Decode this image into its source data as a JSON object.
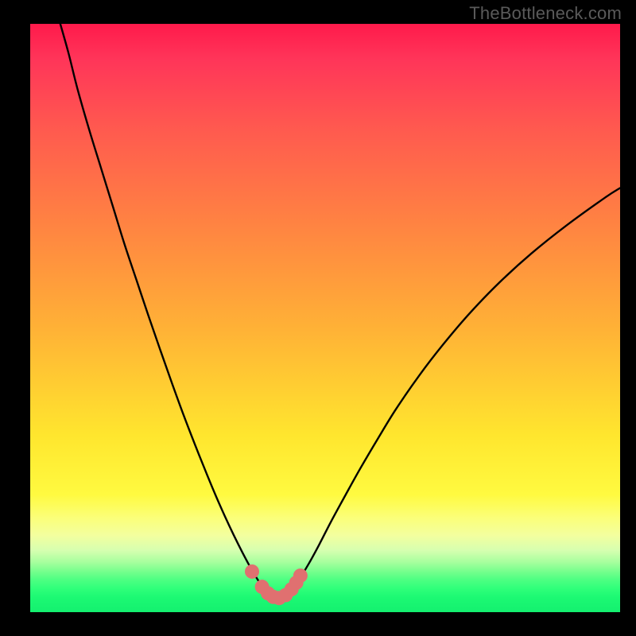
{
  "watermark": "TheBottleneck.com",
  "colors": {
    "frame": "#000000",
    "curve": "#000000",
    "marker": "#e07070"
  },
  "chart_data": {
    "type": "line",
    "title": "",
    "xlabel": "",
    "ylabel": "",
    "xlim": [
      0,
      100
    ],
    "ylim": [
      0,
      100
    ],
    "grid": false,
    "legend": false,
    "annotations": [],
    "x": [
      5.1,
      6.5,
      8.0,
      10.0,
      12.0,
      14.0,
      16.0,
      18.0,
      20.0,
      22.0,
      24.0,
      26.0,
      28.0,
      30.0,
      31.5,
      33.0,
      34.5,
      36.0,
      37.5,
      38.7,
      39.6,
      40.5,
      41.4,
      42.3,
      43.3,
      44.4,
      45.6,
      47.2,
      49.0,
      51.0,
      53.5,
      56.0,
      59.0,
      62.0,
      66.0,
      70.0,
      74.5,
      79.5,
      85.0,
      91.0,
      97.5,
      100.0
    ],
    "y": [
      100.0,
      95.0,
      89.0,
      82.0,
      75.5,
      69.0,
      62.5,
      56.5,
      50.5,
      44.7,
      39.0,
      33.5,
      28.3,
      23.3,
      19.7,
      16.3,
      13.1,
      10.1,
      7.3,
      5.3,
      4.0,
      3.1,
      2.5,
      2.4,
      2.9,
      4.0,
      5.6,
      8.2,
      11.5,
      15.4,
      20.0,
      24.5,
      29.6,
      34.5,
      40.3,
      45.5,
      50.8,
      56.0,
      61.0,
      65.8,
      70.5,
      72.1
    ],
    "markers": {
      "x": [
        37.6,
        39.3,
        40.3,
        41.2,
        42.2,
        43.3,
        44.3,
        45.1,
        45.8
      ],
      "y": [
        6.9,
        4.3,
        3.2,
        2.6,
        2.4,
        2.9,
        3.9,
        5.0,
        6.2
      ]
    }
  }
}
